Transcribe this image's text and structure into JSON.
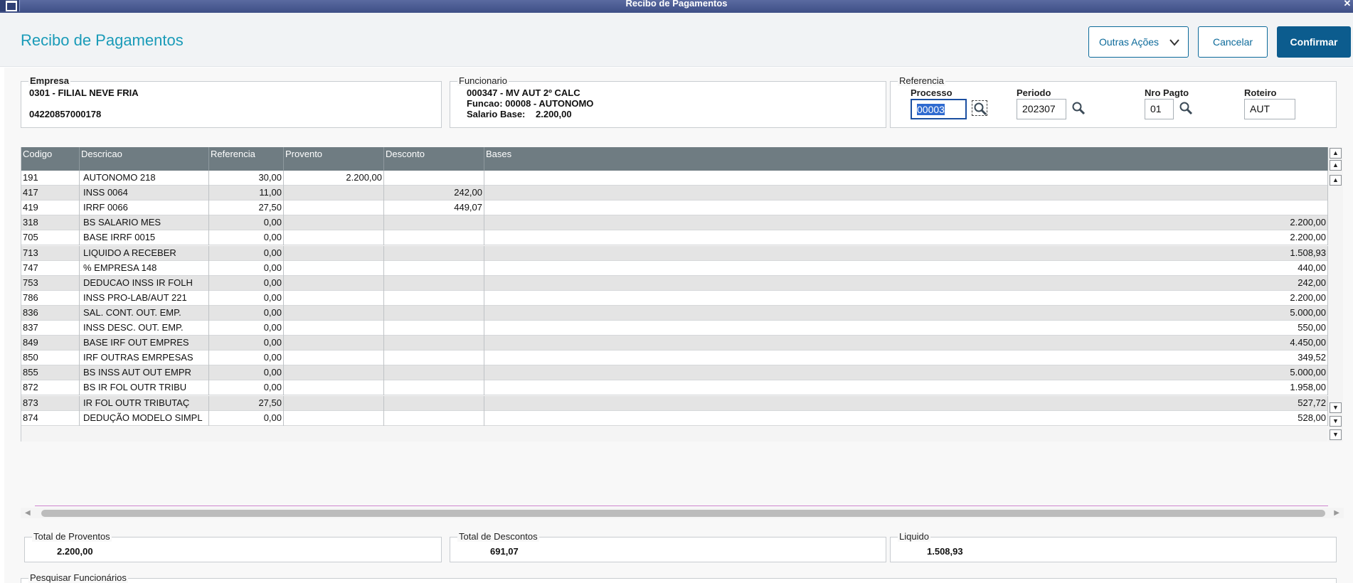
{
  "window": {
    "title": "Recibo de Pagamentos",
    "close_glyph": "✕"
  },
  "header": {
    "title": "Recibo de Pagamentos",
    "more_actions_label": "Outras Ações",
    "cancel_label": "Cancelar",
    "confirm_label": "Confirmar"
  },
  "empresa": {
    "legend": "Empresa",
    "name": "0301 - FILIAL NEVE FRIA",
    "cnpj": "04220857000178"
  },
  "funcionario": {
    "legend": "Funcionario",
    "employee": "000347 - MV AUT 2º CALC",
    "funcao": "Funcao: 00008 - AUTONOMO",
    "salario_label": "Salario Base:",
    "salario_value": "2.200,00"
  },
  "referencia": {
    "legend": "Referencia",
    "processo_label": "Processo",
    "processo_value": "00003",
    "periodo_label": "Periodo",
    "periodo_value": "202307",
    "nro_pagto_label": "Nro Pagto",
    "nro_pagto_value": "01",
    "roteiro_label": "Roteiro",
    "roteiro_value": "AUT"
  },
  "grid": {
    "columns": [
      "Codigo",
      "Descricao",
      "Referencia",
      "Provento",
      "Desconto",
      "Bases"
    ],
    "rows": [
      [
        "191",
        "AUTONOMO 218",
        "30,00",
        "2.200,00",
        "",
        ""
      ],
      [
        "417",
        "INSS 0064",
        "11,00",
        "",
        "242,00",
        ""
      ],
      [
        "419",
        "IRRF 0066",
        "27,50",
        "",
        "449,07",
        ""
      ],
      [
        "318",
        "BS SALARIO MES",
        "0,00",
        "",
        "",
        "2.200,00"
      ],
      [
        "705",
        "BASE IRRF 0015",
        "0,00",
        "",
        "",
        "2.200,00"
      ],
      [
        "713",
        "LIQUIDO A RECEBER",
        "0,00",
        "",
        "",
        "1.508,93"
      ],
      [
        "747",
        "% EMPRESA  148",
        "0,00",
        "",
        "",
        "440,00"
      ],
      [
        "753",
        "DEDUCAO INSS IR FOLH",
        "0,00",
        "",
        "",
        "242,00"
      ],
      [
        "786",
        "INSS PRO-LAB/AUT 221",
        "0,00",
        "",
        "",
        "2.200,00"
      ],
      [
        "836",
        "SAL. CONT. OUT. EMP.",
        "0,00",
        "",
        "",
        "5.000,00"
      ],
      [
        "837",
        "INSS DESC. OUT. EMP.",
        "0,00",
        "",
        "",
        "550,00"
      ],
      [
        "849",
        "BASE IRF OUT EMPRES",
        "0,00",
        "",
        "",
        "4.450,00"
      ],
      [
        "850",
        "IRF OUTRAS EMRPESAS",
        "0,00",
        "",
        "",
        "349,52"
      ],
      [
        "855",
        "BS INSS AUT OUT EMPR",
        "0,00",
        "",
        "",
        "5.000,00"
      ],
      [
        "872",
        "BS IR FOL OUTR TRIBU",
        "0,00",
        "",
        "",
        "1.958,00"
      ],
      [
        "873",
        "IR FOL OUTR TRIBUTAÇ",
        "27,50",
        "",
        "",
        "527,72"
      ],
      [
        "874",
        "DEDUÇÃO MODELO SIMPL",
        "0,00",
        "",
        "",
        "528,00"
      ]
    ]
  },
  "totals": {
    "proventos_label": "Total de Proventos",
    "proventos_value": "2.200,00",
    "descontos_label": "Total de Descontos",
    "descontos_value": "691,07",
    "liquido_label": "Liquido",
    "liquido_value": "1.508,93"
  },
  "search": {
    "legend": "Pesquisar Funcionários"
  },
  "colors": {
    "accent": "#1a9bb8",
    "primary": "#0c5c8e",
    "grid_header": "#6f7c82"
  }
}
